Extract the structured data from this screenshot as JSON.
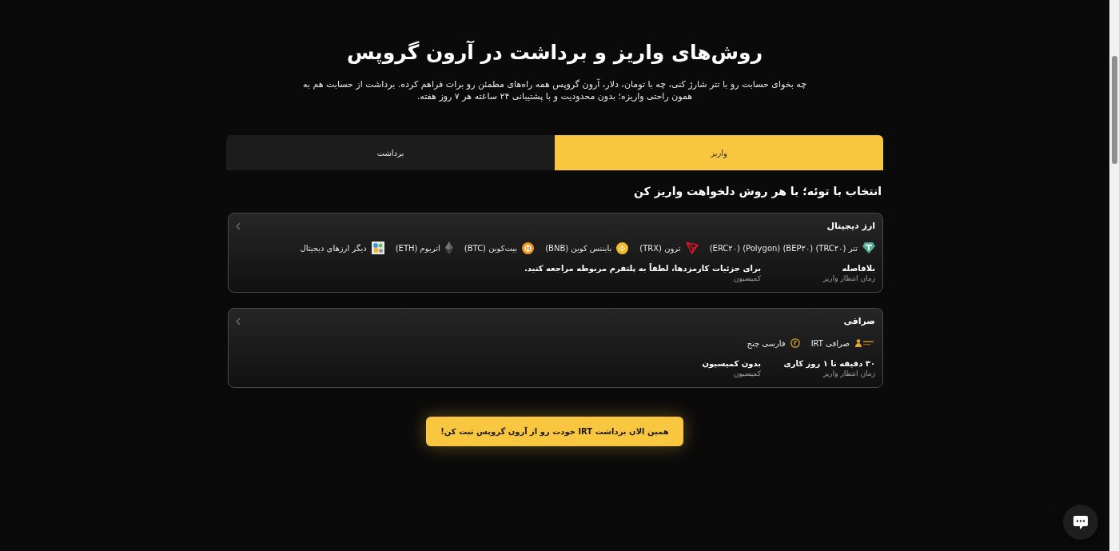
{
  "header": {
    "title": "روش‌های واریز و برداشت در آرون گروپس",
    "subtitle": "چه بخوای حسابت رو با تتر شارژ کنی، چه با تومان، دلار، آرون گروپس همه راه‌های مطمئن رو برات فراهم کرده. برداشت از حسابت هم به همون راحتی واریزه؛ بدون محدودیت و با پشتیبانی ۲۴ ساعته هر ۷ روز هفته."
  },
  "tabs": [
    {
      "label": "واریز",
      "selected": true
    },
    {
      "label": "برداشت",
      "selected": false
    }
  ],
  "section_title": "انتخاب با توئه؛ با هر روش دلخواهت واریز کن",
  "methods": [
    {
      "title": "ارز دیجیتال",
      "options": [
        {
          "name": "تتر",
          "codes": [
            "(TRC۲۰)",
            "(BEP۲۰)",
            "(Polygon)",
            "(ERC۲۰)"
          ]
        },
        {
          "name": "ترون",
          "codes": [
            "(TRX)"
          ]
        },
        {
          "name": "بایننس کوین",
          "codes": [
            "(BNB)"
          ]
        },
        {
          "name": "بیت‌کوین",
          "codes": [
            "(BTC)"
          ]
        },
        {
          "name": "اتریوم",
          "codes": [
            "(ETH)"
          ]
        },
        {
          "name": "دیگر ارزهای دیجیتال"
        }
      ],
      "details": [
        {
          "value": "بلافاصله",
          "label": "زمان انتظار واریز"
        },
        {
          "value": "برای جزئیات کارمزدها، لطفاً به پلتفرم مربوطه مراجعه کنید.",
          "label": "کمیسیون"
        }
      ]
    },
    {
      "title": "صرافی",
      "options": [
        {
          "name": "صرافی",
          "codes": [
            "IRT"
          ]
        },
        {
          "name": "فارسی چنج"
        }
      ],
      "details": [
        {
          "value": "۳۰ دقیقه تا ۱ روز کاری",
          "label": "زمان انتظار واریز"
        },
        {
          "value": "بدون کمیسیون",
          "label": "کمیسیون"
        }
      ]
    }
  ],
  "cta_button": "همین الان برداشت IRT خودت رو از آرون گروپس ثبت کن!"
}
